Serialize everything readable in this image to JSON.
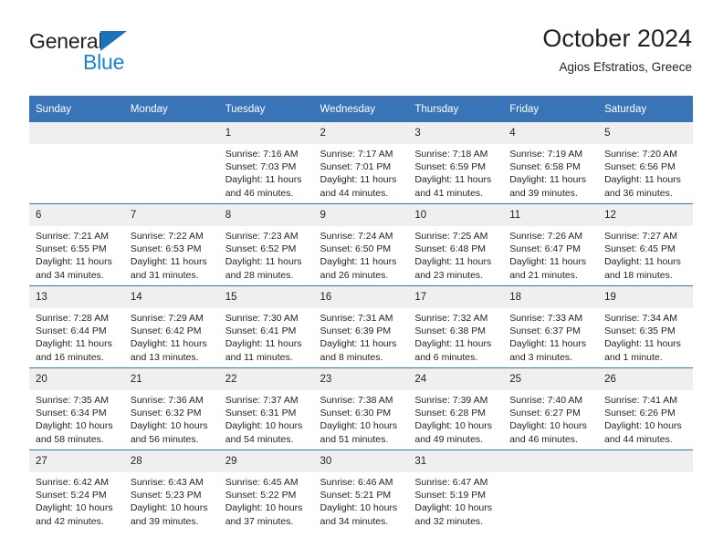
{
  "brand": {
    "name_part1": "General",
    "name_part2": "Blue",
    "accent_color": "#1b72b8",
    "blue_text_color": "#1b83d4"
  },
  "header": {
    "title": "October 2024",
    "subtitle": "Agios Efstratios, Greece"
  },
  "theme": {
    "header_bar_color": "#3a74b8",
    "daynum_band_color": "#efeff0",
    "cell_background": "#ffffff",
    "text_color": "#231f20"
  },
  "weekday_headers": [
    "Sunday",
    "Monday",
    "Tuesday",
    "Wednesday",
    "Thursday",
    "Friday",
    "Saturday"
  ],
  "weeks": [
    [
      {
        "day": "",
        "sunrise": "",
        "sunset": "",
        "daylight_line1": "",
        "daylight_line2": ""
      },
      {
        "day": "",
        "sunrise": "",
        "sunset": "",
        "daylight_line1": "",
        "daylight_line2": ""
      },
      {
        "day": "1",
        "sunrise": "Sunrise: 7:16 AM",
        "sunset": "Sunset: 7:03 PM",
        "daylight_line1": "Daylight: 11 hours",
        "daylight_line2": "and 46 minutes."
      },
      {
        "day": "2",
        "sunrise": "Sunrise: 7:17 AM",
        "sunset": "Sunset: 7:01 PM",
        "daylight_line1": "Daylight: 11 hours",
        "daylight_line2": "and 44 minutes."
      },
      {
        "day": "3",
        "sunrise": "Sunrise: 7:18 AM",
        "sunset": "Sunset: 6:59 PM",
        "daylight_line1": "Daylight: 11 hours",
        "daylight_line2": "and 41 minutes."
      },
      {
        "day": "4",
        "sunrise": "Sunrise: 7:19 AM",
        "sunset": "Sunset: 6:58 PM",
        "daylight_line1": "Daylight: 11 hours",
        "daylight_line2": "and 39 minutes."
      },
      {
        "day": "5",
        "sunrise": "Sunrise: 7:20 AM",
        "sunset": "Sunset: 6:56 PM",
        "daylight_line1": "Daylight: 11 hours",
        "daylight_line2": "and 36 minutes."
      }
    ],
    [
      {
        "day": "6",
        "sunrise": "Sunrise: 7:21 AM",
        "sunset": "Sunset: 6:55 PM",
        "daylight_line1": "Daylight: 11 hours",
        "daylight_line2": "and 34 minutes."
      },
      {
        "day": "7",
        "sunrise": "Sunrise: 7:22 AM",
        "sunset": "Sunset: 6:53 PM",
        "daylight_line1": "Daylight: 11 hours",
        "daylight_line2": "and 31 minutes."
      },
      {
        "day": "8",
        "sunrise": "Sunrise: 7:23 AM",
        "sunset": "Sunset: 6:52 PM",
        "daylight_line1": "Daylight: 11 hours",
        "daylight_line2": "and 28 minutes."
      },
      {
        "day": "9",
        "sunrise": "Sunrise: 7:24 AM",
        "sunset": "Sunset: 6:50 PM",
        "daylight_line1": "Daylight: 11 hours",
        "daylight_line2": "and 26 minutes."
      },
      {
        "day": "10",
        "sunrise": "Sunrise: 7:25 AM",
        "sunset": "Sunset: 6:48 PM",
        "daylight_line1": "Daylight: 11 hours",
        "daylight_line2": "and 23 minutes."
      },
      {
        "day": "11",
        "sunrise": "Sunrise: 7:26 AM",
        "sunset": "Sunset: 6:47 PM",
        "daylight_line1": "Daylight: 11 hours",
        "daylight_line2": "and 21 minutes."
      },
      {
        "day": "12",
        "sunrise": "Sunrise: 7:27 AM",
        "sunset": "Sunset: 6:45 PM",
        "daylight_line1": "Daylight: 11 hours",
        "daylight_line2": "and 18 minutes."
      }
    ],
    [
      {
        "day": "13",
        "sunrise": "Sunrise: 7:28 AM",
        "sunset": "Sunset: 6:44 PM",
        "daylight_line1": "Daylight: 11 hours",
        "daylight_line2": "and 16 minutes."
      },
      {
        "day": "14",
        "sunrise": "Sunrise: 7:29 AM",
        "sunset": "Sunset: 6:42 PM",
        "daylight_line1": "Daylight: 11 hours",
        "daylight_line2": "and 13 minutes."
      },
      {
        "day": "15",
        "sunrise": "Sunrise: 7:30 AM",
        "sunset": "Sunset: 6:41 PM",
        "daylight_line1": "Daylight: 11 hours",
        "daylight_line2": "and 11 minutes."
      },
      {
        "day": "16",
        "sunrise": "Sunrise: 7:31 AM",
        "sunset": "Sunset: 6:39 PM",
        "daylight_line1": "Daylight: 11 hours",
        "daylight_line2": "and 8 minutes."
      },
      {
        "day": "17",
        "sunrise": "Sunrise: 7:32 AM",
        "sunset": "Sunset: 6:38 PM",
        "daylight_line1": "Daylight: 11 hours",
        "daylight_line2": "and 6 minutes."
      },
      {
        "day": "18",
        "sunrise": "Sunrise: 7:33 AM",
        "sunset": "Sunset: 6:37 PM",
        "daylight_line1": "Daylight: 11 hours",
        "daylight_line2": "and 3 minutes."
      },
      {
        "day": "19",
        "sunrise": "Sunrise: 7:34 AM",
        "sunset": "Sunset: 6:35 PM",
        "daylight_line1": "Daylight: 11 hours",
        "daylight_line2": "and 1 minute."
      }
    ],
    [
      {
        "day": "20",
        "sunrise": "Sunrise: 7:35 AM",
        "sunset": "Sunset: 6:34 PM",
        "daylight_line1": "Daylight: 10 hours",
        "daylight_line2": "and 58 minutes."
      },
      {
        "day": "21",
        "sunrise": "Sunrise: 7:36 AM",
        "sunset": "Sunset: 6:32 PM",
        "daylight_line1": "Daylight: 10 hours",
        "daylight_line2": "and 56 minutes."
      },
      {
        "day": "22",
        "sunrise": "Sunrise: 7:37 AM",
        "sunset": "Sunset: 6:31 PM",
        "daylight_line1": "Daylight: 10 hours",
        "daylight_line2": "and 54 minutes."
      },
      {
        "day": "23",
        "sunrise": "Sunrise: 7:38 AM",
        "sunset": "Sunset: 6:30 PM",
        "daylight_line1": "Daylight: 10 hours",
        "daylight_line2": "and 51 minutes."
      },
      {
        "day": "24",
        "sunrise": "Sunrise: 7:39 AM",
        "sunset": "Sunset: 6:28 PM",
        "daylight_line1": "Daylight: 10 hours",
        "daylight_line2": "and 49 minutes."
      },
      {
        "day": "25",
        "sunrise": "Sunrise: 7:40 AM",
        "sunset": "Sunset: 6:27 PM",
        "daylight_line1": "Daylight: 10 hours",
        "daylight_line2": "and 46 minutes."
      },
      {
        "day": "26",
        "sunrise": "Sunrise: 7:41 AM",
        "sunset": "Sunset: 6:26 PM",
        "daylight_line1": "Daylight: 10 hours",
        "daylight_line2": "and 44 minutes."
      }
    ],
    [
      {
        "day": "27",
        "sunrise": "Sunrise: 6:42 AM",
        "sunset": "Sunset: 5:24 PM",
        "daylight_line1": "Daylight: 10 hours",
        "daylight_line2": "and 42 minutes."
      },
      {
        "day": "28",
        "sunrise": "Sunrise: 6:43 AM",
        "sunset": "Sunset: 5:23 PM",
        "daylight_line1": "Daylight: 10 hours",
        "daylight_line2": "and 39 minutes."
      },
      {
        "day": "29",
        "sunrise": "Sunrise: 6:45 AM",
        "sunset": "Sunset: 5:22 PM",
        "daylight_line1": "Daylight: 10 hours",
        "daylight_line2": "and 37 minutes."
      },
      {
        "day": "30",
        "sunrise": "Sunrise: 6:46 AM",
        "sunset": "Sunset: 5:21 PM",
        "daylight_line1": "Daylight: 10 hours",
        "daylight_line2": "and 34 minutes."
      },
      {
        "day": "31",
        "sunrise": "Sunrise: 6:47 AM",
        "sunset": "Sunset: 5:19 PM",
        "daylight_line1": "Daylight: 10 hours",
        "daylight_line2": "and 32 minutes."
      },
      {
        "day": "",
        "sunrise": "",
        "sunset": "",
        "daylight_line1": "",
        "daylight_line2": ""
      },
      {
        "day": "",
        "sunrise": "",
        "sunset": "",
        "daylight_line1": "",
        "daylight_line2": ""
      }
    ]
  ]
}
